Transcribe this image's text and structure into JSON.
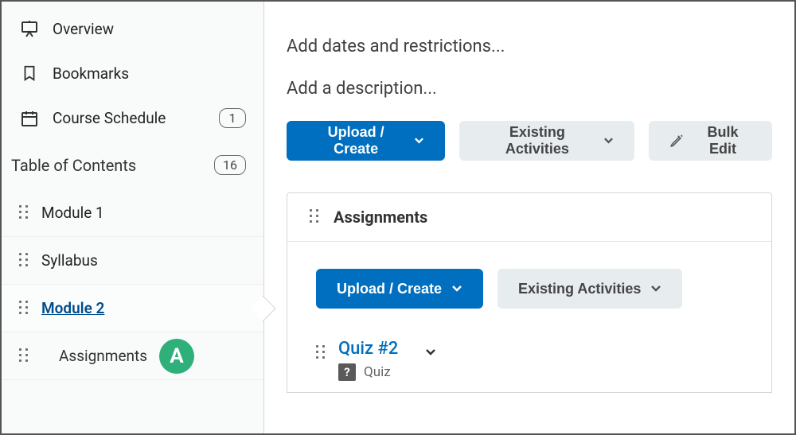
{
  "sidebar": {
    "overview": "Overview",
    "bookmarks": "Bookmarks",
    "schedule": "Course Schedule",
    "schedule_count": "1",
    "toc": "Table of Contents",
    "toc_count": "16",
    "modules": [
      {
        "label": "Module 1"
      },
      {
        "label": "Syllabus"
      },
      {
        "label": "Module 2",
        "active": true
      },
      {
        "label": "Assignments",
        "sub": true
      }
    ],
    "badge_letter": "A"
  },
  "main": {
    "dates_link": "Add dates and restrictions...",
    "desc_link": "Add a description...",
    "buttons": {
      "upload": "Upload / Create",
      "existing": "Existing Activities",
      "bulk": "Bulk Edit"
    },
    "panel": {
      "title": "Assignments",
      "buttons": {
        "upload": "Upload / Create",
        "existing": "Existing Activities"
      },
      "item": {
        "title": "Quiz #2",
        "type": "Quiz"
      }
    }
  }
}
